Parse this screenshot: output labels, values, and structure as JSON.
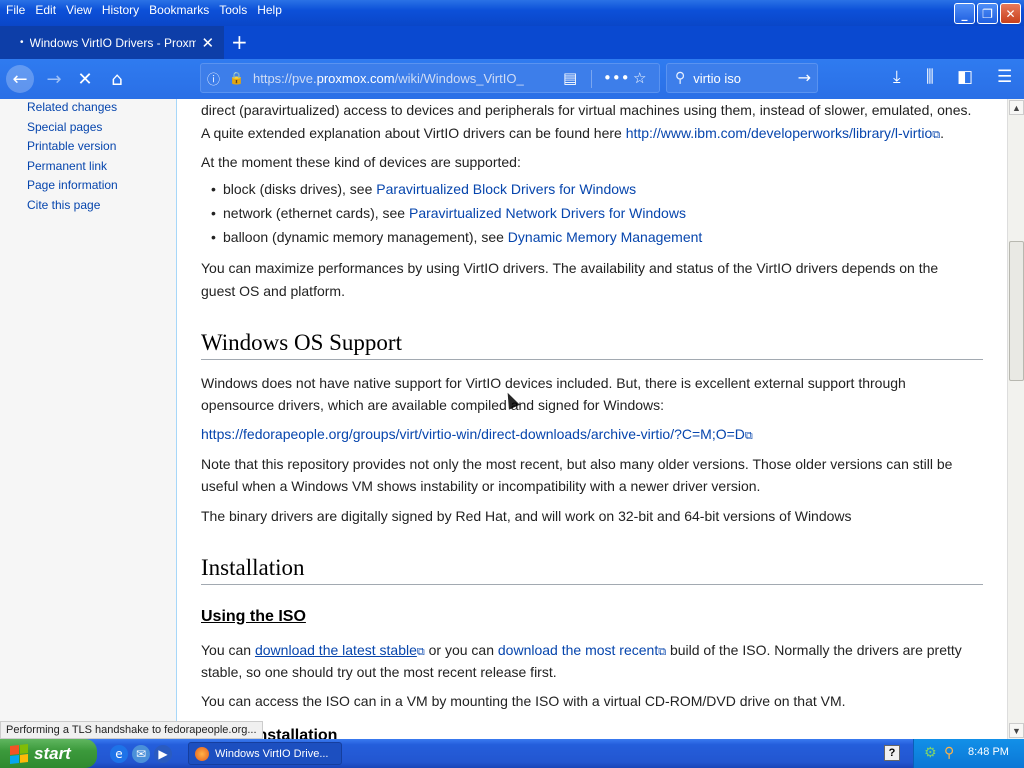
{
  "menu": [
    "File",
    "Edit",
    "View",
    "History",
    "Bookmarks",
    "Tools",
    "Help"
  ],
  "window_buttons": {
    "minimize": "_",
    "maximize": "❐",
    "close": "✕"
  },
  "tab": {
    "title": "Windows VirtIO Drivers - Proxmox",
    "close": "✕",
    "new": "+"
  },
  "nav": {
    "url_prefix": "https://pve.",
    "url_domain": "proxmox.com",
    "url_rest": "/wiki/Windows_VirtIO_",
    "search_value": "virtio iso"
  },
  "sidebar": {
    "links": [
      "Related changes",
      "Special pages",
      "Printable version",
      "Permanent link",
      "Page information",
      "Cite this page"
    ]
  },
  "content": {
    "intro1": "direct (paravirtualized) access to devices and peripherals for virtual machines using them, instead of slower, emulated, ones.",
    "intro2_text": "A quite extended explanation about VirtIO drivers can be found here ",
    "intro2_link": "http://www.ibm.com/developerworks/library/l-virtio",
    "supported_intro": "At the moment these kind of devices are supported:",
    "bullets": [
      {
        "text": "block (disks drives), see ",
        "link": "Paravirtualized Block Drivers for Windows"
      },
      {
        "text": "network (ethernet cards), see ",
        "link": "Paravirtualized Network Drivers for Windows"
      },
      {
        "text": "balloon (dynamic memory management), see ",
        "link": "Dynamic Memory Management"
      }
    ],
    "maximize_1": "You can maximize performances by using VirtIO drivers. The availability and status of the VirtIO drivers depends on the",
    "maximize_2": "guest OS and platform.",
    "h_windows": "Windows OS Support",
    "win_1": "Windows does not have native support for VirtIO devices included. But, there is excellent external support through",
    "win_2": "opensource drivers, which are available compiled and signed for Windows:",
    "fedora_link": "https://fedorapeople.org/groups/virt/virtio-win/direct-downloads/archive-virtio/?C=M;O=D",
    "repo_1": "Note that this repository provides not only the most recent, but also many older versions. Those older versions can still be",
    "repo_2": "useful when a Windows VM shows instability or incompatibility with a newer driver version.",
    "signed": "The binary drivers are digitally signed by Red Hat, and will work on 32-bit and 64-bit versions of Windows",
    "h_installation": "Installation",
    "h_using_iso": "Using the ISO",
    "iso_a": "You can ",
    "iso_link1": "download the latest stable",
    "iso_b": " or you can ",
    "iso_link2": "download the most recent",
    "iso_c": " build of the ISO. Normally the drivers are pretty",
    "iso_2": "stable, so one should try out the most recent release first.",
    "access": "You can access the ISO can in a VM by mounting the ISO with a virtual CD-ROM/DVD drive on that VM.",
    "cut_heading": "installation"
  },
  "status_text": "Performing a TLS handshake to fedorapeople.org...",
  "taskbar": {
    "start": "start",
    "task": "Windows VirtIO Drive...",
    "clock": "8:48 PM"
  }
}
